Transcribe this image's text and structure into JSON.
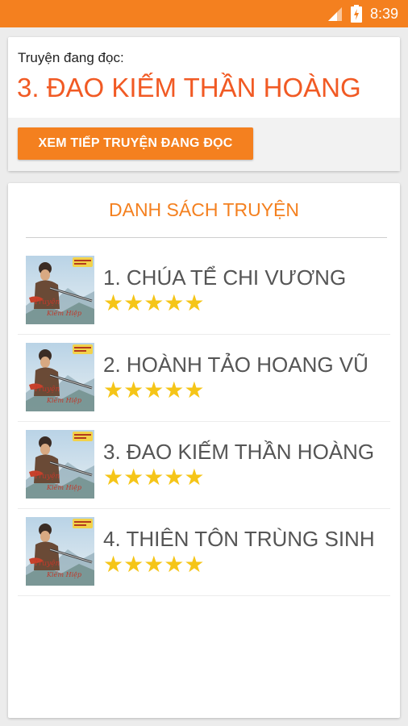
{
  "status_bar": {
    "time": "8:39"
  },
  "reading": {
    "label": "Truyện đang đọc:",
    "title": "3. ĐAO KIẾM THẦN HOÀNG",
    "continue_button": "XEM TIẾP TRUYỆN ĐANG ĐỌC"
  },
  "story_list": {
    "heading": "DANH SÁCH TRUYỆN",
    "items": [
      {
        "title": "1. CHÚA TỂ CHI VƯƠNG",
        "stars": "★★★★★",
        "rating": 5
      },
      {
        "title": "2. HOÀNH TẢO HOANG VŨ",
        "stars": "★★★★★",
        "rating": 5
      },
      {
        "title": "3. ĐAO KIẾM THẦN HOÀNG",
        "stars": "★★★★★",
        "rating": 5
      },
      {
        "title": "4. THIÊN TÔN TRÙNG SINH",
        "stars": "★★★★★",
        "rating": 5
      }
    ]
  },
  "colors": {
    "accent": "#f4801f",
    "title_red": "#f15a24",
    "star": "#f5c518"
  },
  "icons": [
    "signal-icon",
    "battery-icon",
    "story-cover-image"
  ]
}
